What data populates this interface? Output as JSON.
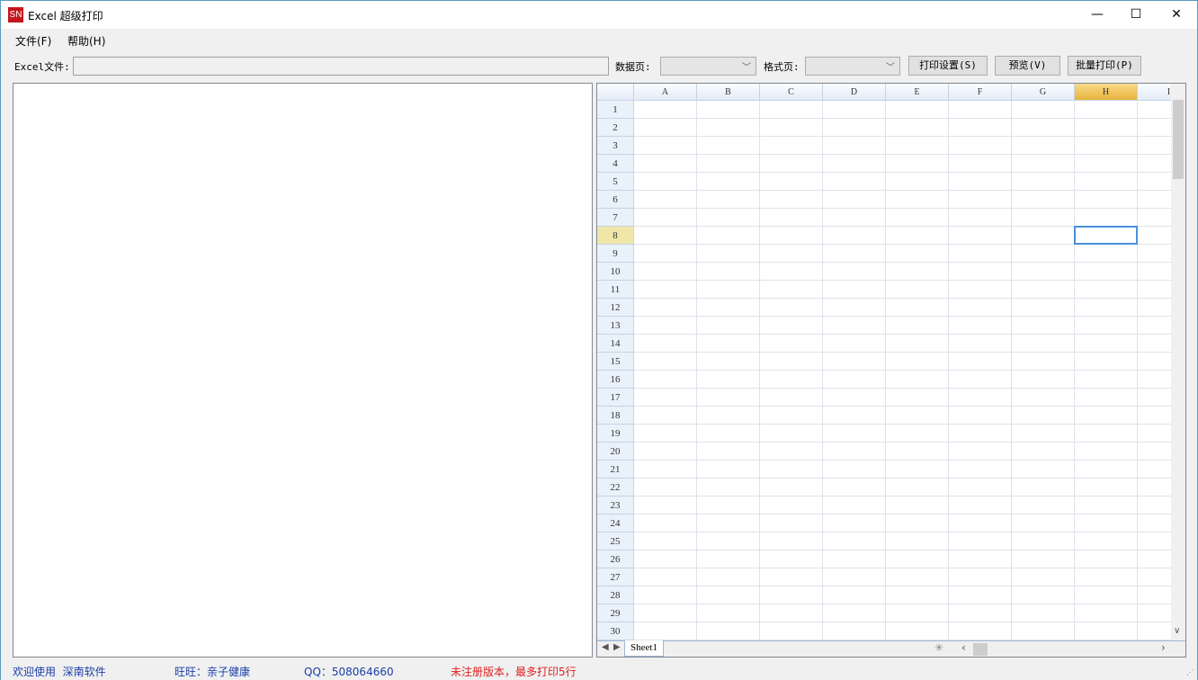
{
  "window": {
    "title": "Excel 超级打印",
    "logo": "SN",
    "minimize": "—",
    "maximize": "☐",
    "close": "✕"
  },
  "menu": [
    {
      "label": "文件(F)"
    },
    {
      "label": "帮助(H)"
    }
  ],
  "toolbar": {
    "file_label": "Excel文件:",
    "file_value": "",
    "data_page_label": "数据页:",
    "data_page_value": "",
    "format_page_label": "格式页:",
    "format_page_value": "",
    "print_settings": "打印设置(S)",
    "preview": "预览(V)",
    "batch_print": "批量打印(P)"
  },
  "sheet": {
    "columns": [
      "A",
      "B",
      "C",
      "D",
      "E",
      "F",
      "G",
      "H",
      "I"
    ],
    "row_count": 30,
    "selected_column": "H",
    "selected_row": 8,
    "tab": "Sheet1"
  },
  "status": {
    "welcome": "欢迎使用  深南软件",
    "wangwang": "旺旺：亲子健康",
    "qq": "QQ：508064660",
    "notice": "未注册版本，最多打印5行",
    "notice_color": "#e02020",
    "info_color": "#1a3ea8"
  }
}
